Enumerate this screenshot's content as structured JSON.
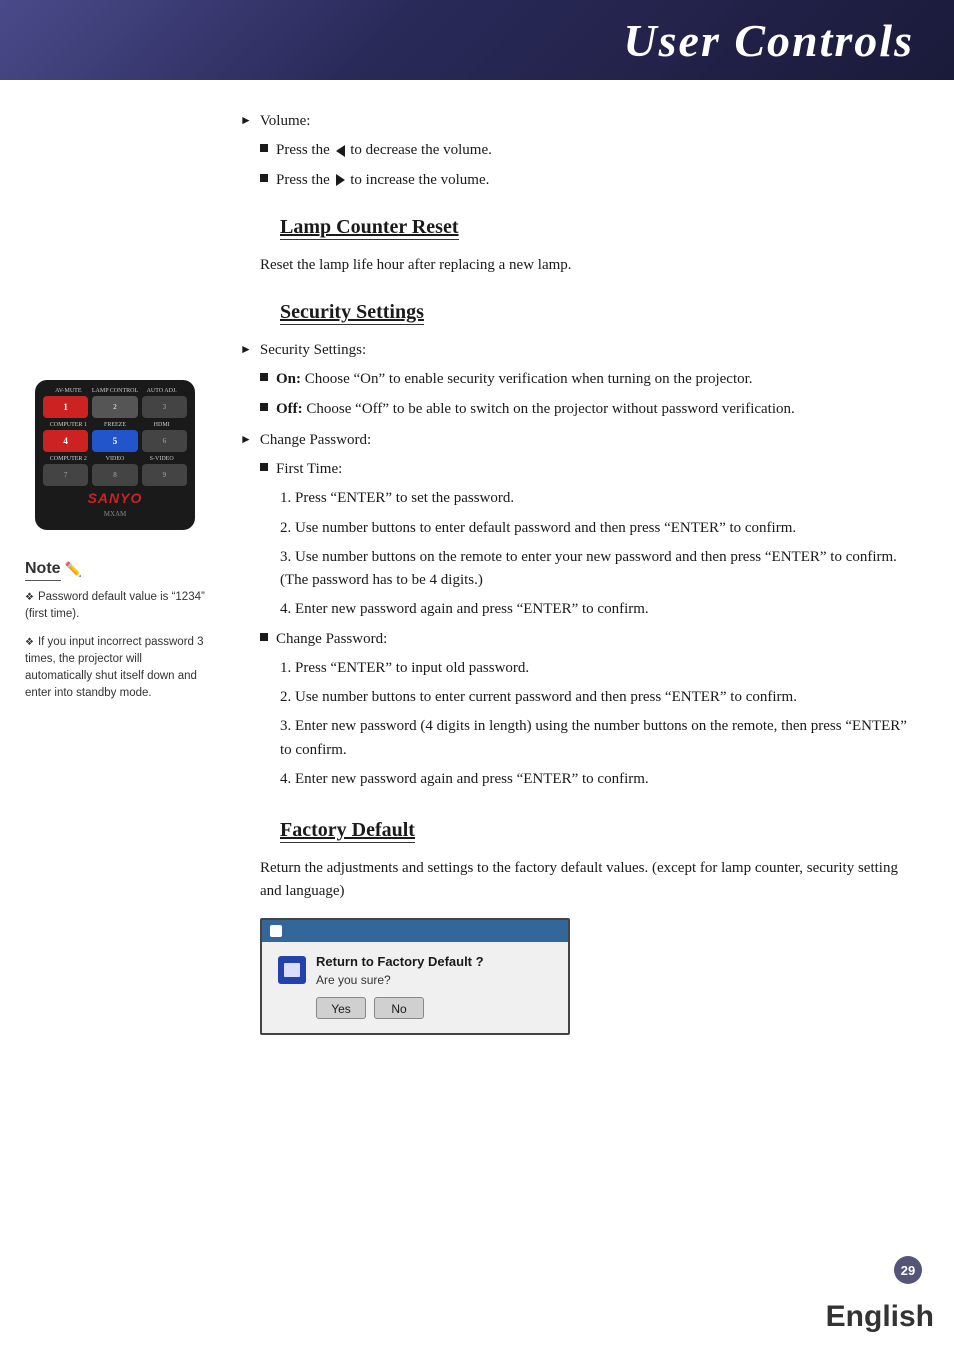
{
  "header": {
    "title": "User Controls"
  },
  "page_number": "29",
  "language": "English",
  "content": {
    "volume_section": {
      "label": "Volume:",
      "decrease": "Press the",
      "decrease_suffix": "to decrease the volume.",
      "increase": "Press the",
      "increase_suffix": "to increase the volume."
    },
    "lamp_counter": {
      "heading": "Lamp Counter Reset",
      "description": "Reset the lamp life hour after replacing a new lamp."
    },
    "security_settings": {
      "heading": "Security Settings",
      "label": "Security Settings:",
      "on_label": "On:",
      "on_text": "Choose “On” to enable security verification when turning on the projector.",
      "off_label": "Off:",
      "off_text": "Choose “Off” to be able to switch on the projector without password verification.",
      "change_password_label": "Change Password:",
      "first_time_label": "First Time:",
      "steps_first_time": [
        "1. Press “ENTER” to set the password.",
        "2. Use number buttons to enter default password and then press “ENTER” to confirm.",
        "3. Use number buttons on the remote to enter your new password and then press “ENTER” to confirm. (The password has to be 4 digits.)",
        "4. Enter new password again and press “ENTER” to confirm."
      ],
      "change_password_sub_label": "Change Password:",
      "steps_change": [
        "1. Press “ENTER” to input old password.",
        "2. Use number buttons to enter current password and then press “ENTER” to confirm.",
        "3. Enter new password (4 digits in length) using the number buttons on the remote, then press “ENTER” to confirm.",
        "4. Enter new password again and press “ENTER” to confirm."
      ]
    },
    "factory_default": {
      "heading": "Factory Default",
      "description": "Return the adjustments and settings to the factory default values. (except for lamp counter, security setting and language)",
      "dialog": {
        "title": "Return to Factory Default ?",
        "subtitle": "Are you sure?",
        "yes_btn": "Yes",
        "no_btn": "No"
      }
    }
  },
  "sidebar": {
    "remote": {
      "labels_row": [
        "AV-MUTE",
        "LAMP CONTROL",
        "AUTO ADJ."
      ],
      "row1": [
        "1",
        "2",
        "3"
      ],
      "row1_labels": [
        "COMPUTER 1",
        "FREEZE",
        "HDMI"
      ],
      "row2": [
        "4",
        "5",
        "6"
      ],
      "row2_labels": [
        "COMPUTER 2",
        "VIDEO",
        "S-VIDEO"
      ],
      "row3": [
        "7",
        "8",
        "9"
      ],
      "brand": "SANYO",
      "model": "MXAM"
    },
    "note": {
      "title": "Note",
      "items": [
        "Password default value is “1234” (first time).",
        "If you input incorrect password 3 times, the projector will automatically shut itself down and enter into standby mode."
      ]
    }
  }
}
